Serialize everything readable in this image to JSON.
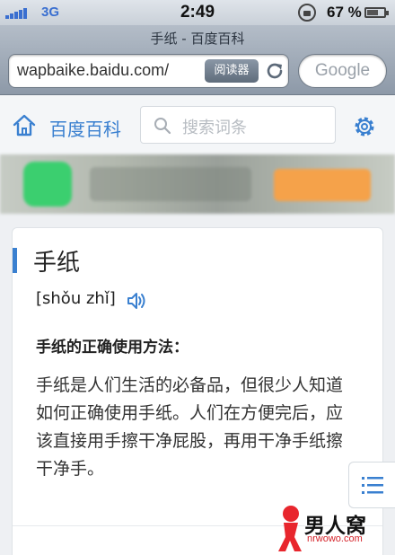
{
  "status": {
    "carrier": "3G",
    "time": "2:49",
    "battery": "67 %",
    "battery_level": 0.67
  },
  "browser": {
    "page_title": "手纸 - 百度百科",
    "url": "wapbaike.baidu.com/",
    "reader_label": "阅读器",
    "search_placeholder": "Google"
  },
  "header": {
    "brand": "百度百科",
    "search_placeholder": "搜索词条"
  },
  "article": {
    "title": "手纸",
    "pinyin": "[shǒu zhǐ]",
    "subheading": "手纸的正确使用方法：",
    "paragraph": "手纸是人们生活的必备品，但很少人知道如何正确使用手纸。人们在方便完后，应该直接用手擦干净屁股，再用干净手纸擦干净手。"
  },
  "watermark": {
    "name": "男人窝",
    "domain": "nrwowo.com"
  },
  "colors": {
    "accent": "#3a80d0",
    "chrome": "#9aa6b4"
  }
}
